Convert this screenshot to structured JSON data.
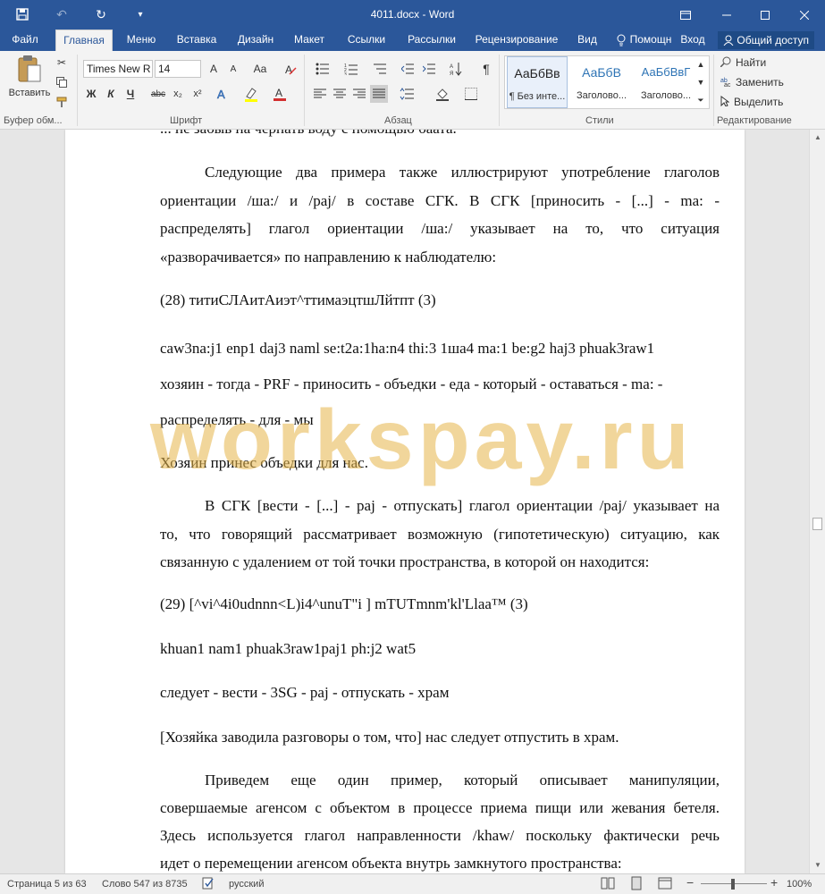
{
  "app": {
    "window_title": "4011.docx - Word",
    "quick_access": [
      "save-icon",
      "undo-icon",
      "redo-icon",
      "customize-icon"
    ]
  },
  "tabs": [
    {
      "label": "Файл"
    },
    {
      "label": "Главная"
    },
    {
      "label": "Меню"
    },
    {
      "label": "Вставка"
    },
    {
      "label": "Дизайн"
    },
    {
      "label": "Макет"
    },
    {
      "label": "Ссылки"
    },
    {
      "label": "Рассылки"
    },
    {
      "label": "Рецензирование"
    },
    {
      "label": "Вид"
    },
    {
      "label": "Помощн"
    },
    {
      "label": "Вход"
    }
  ],
  "share_label": "Общий доступ",
  "ribbon": {
    "paste_label": "Вставить",
    "clipboard_label": "Буфер обм...",
    "font_label": "Шрифт",
    "paragraph_label": "Абзац",
    "styles_label": "Стили",
    "editing_label": "Редактирование",
    "font_name": "Times New R",
    "font_size": "14",
    "grow_font": "A",
    "shrink_font": "A",
    "change_case": "Aa",
    "bold": "Ж",
    "italic": "К",
    "underline": "Ч",
    "strike": "abc",
    "subscript": "x₂",
    "superscript": "x²",
    "styles": [
      {
        "sample": "АаБбВв",
        "name": "¶ Без инте..."
      },
      {
        "sample": "АаБбВ",
        "name": "Заголово..."
      },
      {
        "sample": "АаБбВвГ",
        "name": "Заголово..."
      }
    ],
    "find_label": "Найти",
    "replace_label": "Заменить",
    "select_label": "Выделить"
  },
  "document": {
    "line0": "... не забыв на черпать воду с помощью баата.",
    "p1_l1": "Следующие два примера также иллюстрируют употребление глаголов",
    "p1_l2": "ориентации /ша:/ и /paj/ в составе СГК. В СГК [приносить - [...] - ma: -",
    "p1_l3": "распределять] глагол ориентации /ша:/ указывает на то, что ситуация",
    "p1_l4": "«разворачивается» по направлению к наблюдателю:",
    "ex28": "(28)   титиСЛАитАиэт^ттимаэцтшЛйтпт (3)",
    "ex28_translit": "caw3na:j1 enp1 daj3 naml se:t2a:1ha:n4 thi:3 1ша4 ma:1 be:g2 haj3 phuak3raw1",
    "ex28_gloss_l1": "хозяин - тогда - PRF - приносить - объедки - еда - который - оставаться - ma: -",
    "ex28_gloss_l2": "распределять - для - мы",
    "ex28_translation": "Хозяин принес объедки для нас.",
    "p2_l1": "В СГК [вести - [...] - paj - отпускать] глагол ориентации /paj/ указывает на",
    "p2_l2": "то, что говорящий рассматривает возможную (гипотетическую) ситуацию, как",
    "p2_l3": "связанную с удалением от той точки пространства, в которой он находится:",
    "ex29": "(29)   [^vi^4i0udnnn<L)i4^unuT\"i ] mTUTmnm'kl'Llaa™ (3)",
    "ex29_translit": "khuan1 nam1 phuak3raw1paj1 ph:j2 wat5",
    "ex29_gloss": "следует - вести - 3SG - paj - отпускать - храм",
    "ex29_translation": "[Хозяйка заводила разговоры о том, что] нас следует отпустить в храм.",
    "p3_l1": "Приведем еще один пример, который описывает манипуляции,",
    "p3_l2": "совершаемые агенсом с объектом в процессе приема пищи или жевания бетеля.",
    "p3_l3": "Здесь используется глагол направленности /khaw/ поскольку фактически речь",
    "p3_l4": "идет о перемещении агенсом объекта внутрь замкнутого пространства:"
  },
  "watermark": "workspay.ru",
  "status": {
    "page": "Страница 5 из 63",
    "words": "Слово 547 из 8735",
    "language": "русский",
    "zoom": "100%"
  }
}
